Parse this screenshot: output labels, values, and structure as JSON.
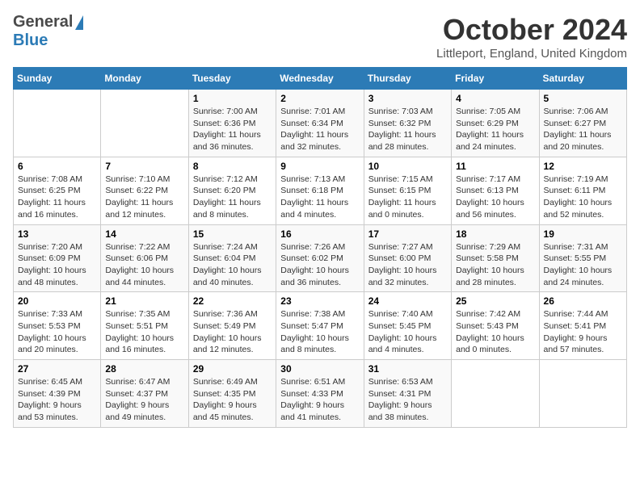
{
  "header": {
    "logo_general": "General",
    "logo_blue": "Blue",
    "month_title": "October 2024",
    "location": "Littleport, England, United Kingdom"
  },
  "days_of_week": [
    "Sunday",
    "Monday",
    "Tuesday",
    "Wednesday",
    "Thursday",
    "Friday",
    "Saturday"
  ],
  "weeks": [
    [
      {
        "day": "",
        "info": ""
      },
      {
        "day": "",
        "info": ""
      },
      {
        "day": "1",
        "info": "Sunrise: 7:00 AM\nSunset: 6:36 PM\nDaylight: 11 hours and 36 minutes."
      },
      {
        "day": "2",
        "info": "Sunrise: 7:01 AM\nSunset: 6:34 PM\nDaylight: 11 hours and 32 minutes."
      },
      {
        "day": "3",
        "info": "Sunrise: 7:03 AM\nSunset: 6:32 PM\nDaylight: 11 hours and 28 minutes."
      },
      {
        "day": "4",
        "info": "Sunrise: 7:05 AM\nSunset: 6:29 PM\nDaylight: 11 hours and 24 minutes."
      },
      {
        "day": "5",
        "info": "Sunrise: 7:06 AM\nSunset: 6:27 PM\nDaylight: 11 hours and 20 minutes."
      }
    ],
    [
      {
        "day": "6",
        "info": "Sunrise: 7:08 AM\nSunset: 6:25 PM\nDaylight: 11 hours and 16 minutes."
      },
      {
        "day": "7",
        "info": "Sunrise: 7:10 AM\nSunset: 6:22 PM\nDaylight: 11 hours and 12 minutes."
      },
      {
        "day": "8",
        "info": "Sunrise: 7:12 AM\nSunset: 6:20 PM\nDaylight: 11 hours and 8 minutes."
      },
      {
        "day": "9",
        "info": "Sunrise: 7:13 AM\nSunset: 6:18 PM\nDaylight: 11 hours and 4 minutes."
      },
      {
        "day": "10",
        "info": "Sunrise: 7:15 AM\nSunset: 6:15 PM\nDaylight: 11 hours and 0 minutes."
      },
      {
        "day": "11",
        "info": "Sunrise: 7:17 AM\nSunset: 6:13 PM\nDaylight: 10 hours and 56 minutes."
      },
      {
        "day": "12",
        "info": "Sunrise: 7:19 AM\nSunset: 6:11 PM\nDaylight: 10 hours and 52 minutes."
      }
    ],
    [
      {
        "day": "13",
        "info": "Sunrise: 7:20 AM\nSunset: 6:09 PM\nDaylight: 10 hours and 48 minutes."
      },
      {
        "day": "14",
        "info": "Sunrise: 7:22 AM\nSunset: 6:06 PM\nDaylight: 10 hours and 44 minutes."
      },
      {
        "day": "15",
        "info": "Sunrise: 7:24 AM\nSunset: 6:04 PM\nDaylight: 10 hours and 40 minutes."
      },
      {
        "day": "16",
        "info": "Sunrise: 7:26 AM\nSunset: 6:02 PM\nDaylight: 10 hours and 36 minutes."
      },
      {
        "day": "17",
        "info": "Sunrise: 7:27 AM\nSunset: 6:00 PM\nDaylight: 10 hours and 32 minutes."
      },
      {
        "day": "18",
        "info": "Sunrise: 7:29 AM\nSunset: 5:58 PM\nDaylight: 10 hours and 28 minutes."
      },
      {
        "day": "19",
        "info": "Sunrise: 7:31 AM\nSunset: 5:55 PM\nDaylight: 10 hours and 24 minutes."
      }
    ],
    [
      {
        "day": "20",
        "info": "Sunrise: 7:33 AM\nSunset: 5:53 PM\nDaylight: 10 hours and 20 minutes."
      },
      {
        "day": "21",
        "info": "Sunrise: 7:35 AM\nSunset: 5:51 PM\nDaylight: 10 hours and 16 minutes."
      },
      {
        "day": "22",
        "info": "Sunrise: 7:36 AM\nSunset: 5:49 PM\nDaylight: 10 hours and 12 minutes."
      },
      {
        "day": "23",
        "info": "Sunrise: 7:38 AM\nSunset: 5:47 PM\nDaylight: 10 hours and 8 minutes."
      },
      {
        "day": "24",
        "info": "Sunrise: 7:40 AM\nSunset: 5:45 PM\nDaylight: 10 hours and 4 minutes."
      },
      {
        "day": "25",
        "info": "Sunrise: 7:42 AM\nSunset: 5:43 PM\nDaylight: 10 hours and 0 minutes."
      },
      {
        "day": "26",
        "info": "Sunrise: 7:44 AM\nSunset: 5:41 PM\nDaylight: 9 hours and 57 minutes."
      }
    ],
    [
      {
        "day": "27",
        "info": "Sunrise: 6:45 AM\nSunset: 4:39 PM\nDaylight: 9 hours and 53 minutes."
      },
      {
        "day": "28",
        "info": "Sunrise: 6:47 AM\nSunset: 4:37 PM\nDaylight: 9 hours and 49 minutes."
      },
      {
        "day": "29",
        "info": "Sunrise: 6:49 AM\nSunset: 4:35 PM\nDaylight: 9 hours and 45 minutes."
      },
      {
        "day": "30",
        "info": "Sunrise: 6:51 AM\nSunset: 4:33 PM\nDaylight: 9 hours and 41 minutes."
      },
      {
        "day": "31",
        "info": "Sunrise: 6:53 AM\nSunset: 4:31 PM\nDaylight: 9 hours and 38 minutes."
      },
      {
        "day": "",
        "info": ""
      },
      {
        "day": "",
        "info": ""
      }
    ]
  ]
}
